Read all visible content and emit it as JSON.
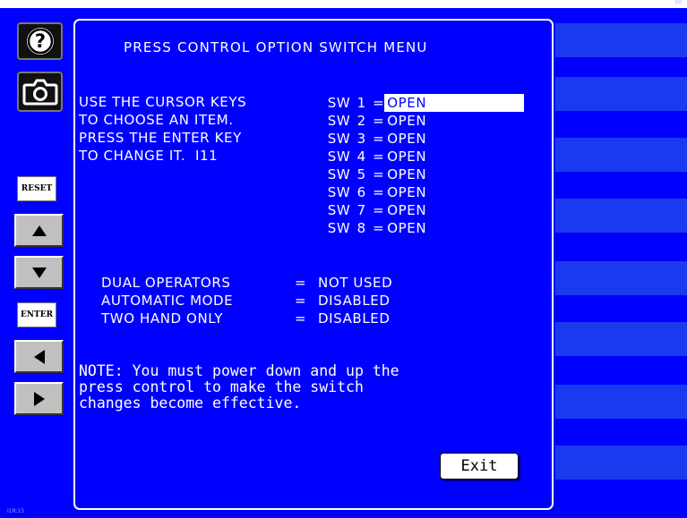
{
  "menu": {
    "title": "PRESS CONTROL OPTION SWITCH MENU",
    "instructions": [
      "USE THE CURSOR KEYS",
      "TO CHOOSE AN ITEM.",
      "PRESS THE ENTER KEY",
      "TO CHANGE IT.  I11"
    ]
  },
  "switches": [
    {
      "label": "SW",
      "number": "1",
      "eq": "=",
      "value": "OPEN"
    },
    {
      "label": "SW",
      "number": "2",
      "eq": "=",
      "value": "OPEN"
    },
    {
      "label": "SW",
      "number": "3",
      "eq": "=",
      "value": "OPEN"
    },
    {
      "label": "SW",
      "number": "4",
      "eq": "=",
      "value": "OPEN"
    },
    {
      "label": "SW",
      "number": "5",
      "eq": "=",
      "value": "OPEN"
    },
    {
      "label": "SW",
      "number": "6",
      "eq": "=",
      "value": "OPEN"
    },
    {
      "label": "SW",
      "number": "7",
      "eq": "=",
      "value": "OPEN"
    },
    {
      "label": "SW",
      "number": "8",
      "eq": "=",
      "value": "OPEN"
    }
  ],
  "settings": [
    {
      "label": "DUAL OPERATORS",
      "eq": "=",
      "value": "NOT USED"
    },
    {
      "label": "AUTOMATIC MODE",
      "eq": "=",
      "value": "DISABLED"
    },
    {
      "label": "TWO HAND ONLY",
      "eq": "=",
      "value": "DISABLED"
    }
  ],
  "note": [
    "NOTE: You must power down and up the",
    "press control to make the switch",
    "changes become effective."
  ],
  "exit_label": "Exit",
  "sidebar": {
    "reset_label": "RESET",
    "enter_label": "ENTER",
    "help_icon": "help-icon",
    "camera_icon": "camera-icon"
  },
  "corner": {
    "top_right": "50",
    "bottom_left": "I1R:15"
  },
  "colors": {
    "background": "#0000ff",
    "text": "#ffffff",
    "button_gray": "#c0c0c0",
    "stripe": "#1a3af0"
  }
}
